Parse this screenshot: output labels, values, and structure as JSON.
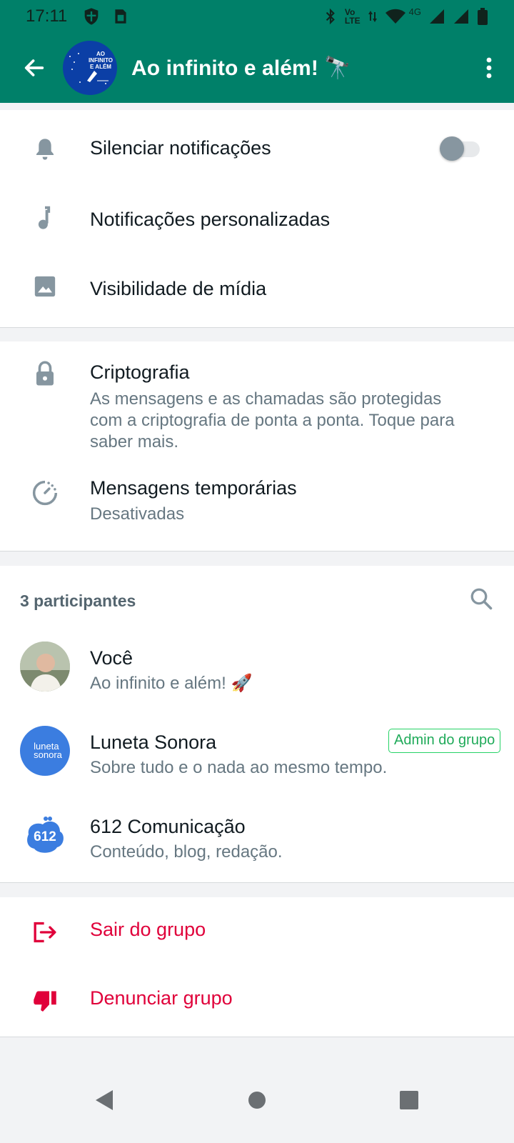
{
  "status_bar": {
    "time": "17:11",
    "left_icons": [
      "shield-icon",
      "sim-card-icon"
    ],
    "right_icons": [
      "bluetooth-icon",
      "volte-icon",
      "data-arrows-icon",
      "wifi-icon",
      "signal-icon",
      "signal-icon",
      "battery-icon"
    ],
    "volte_label_top": "Vo",
    "volte_label_bottom": "LTE",
    "network_label": "4G"
  },
  "app_bar": {
    "title": "Ao infinito e além! 🔭",
    "avatar_text_line1": "AO INFINITO",
    "avatar_text_line2": "E ALÉM",
    "bg_color": "#008069"
  },
  "settings": {
    "mute": {
      "label": "Silenciar notificações",
      "enabled": false,
      "icon": "bell-icon"
    },
    "custom_notifications": {
      "label": "Notificações personalizadas",
      "icon": "music-note-icon"
    },
    "media_visibility": {
      "label": "Visibilidade de mídia",
      "icon": "image-icon"
    }
  },
  "security": {
    "encryption": {
      "title": "Criptografia",
      "subtitle": "As mensagens e as chamadas são protegidas com a criptografia de ponta a ponta. Toque para saber mais.",
      "icon": "lock-icon"
    },
    "disappearing": {
      "title": "Mensagens temporárias",
      "subtitle": "Desativadas",
      "icon": "timer-icon"
    }
  },
  "participants": {
    "header": "3 participantes",
    "items": [
      {
        "name": "Você",
        "status": "Ao infinito e além! 🚀",
        "badge": ""
      },
      {
        "name": "Luneta Sonora",
        "status": "Sobre tudo e o nada ao mesmo tempo.",
        "badge": "Admin do grupo",
        "avatar_line1": "luneta",
        "avatar_line2": "sonora"
      },
      {
        "name": "612 Comunicação",
        "status": "Conteúdo, blog, redação.",
        "badge": "",
        "avatar_text": "612"
      }
    ]
  },
  "actions": {
    "exit": {
      "label": "Sair do grupo",
      "icon": "exit-icon"
    },
    "report": {
      "label": "Denunciar grupo",
      "icon": "thumbs-down-icon"
    },
    "danger_color": "#e0003a"
  },
  "nav": [
    "back-triangle-icon",
    "home-circle-icon",
    "recents-square-icon"
  ]
}
